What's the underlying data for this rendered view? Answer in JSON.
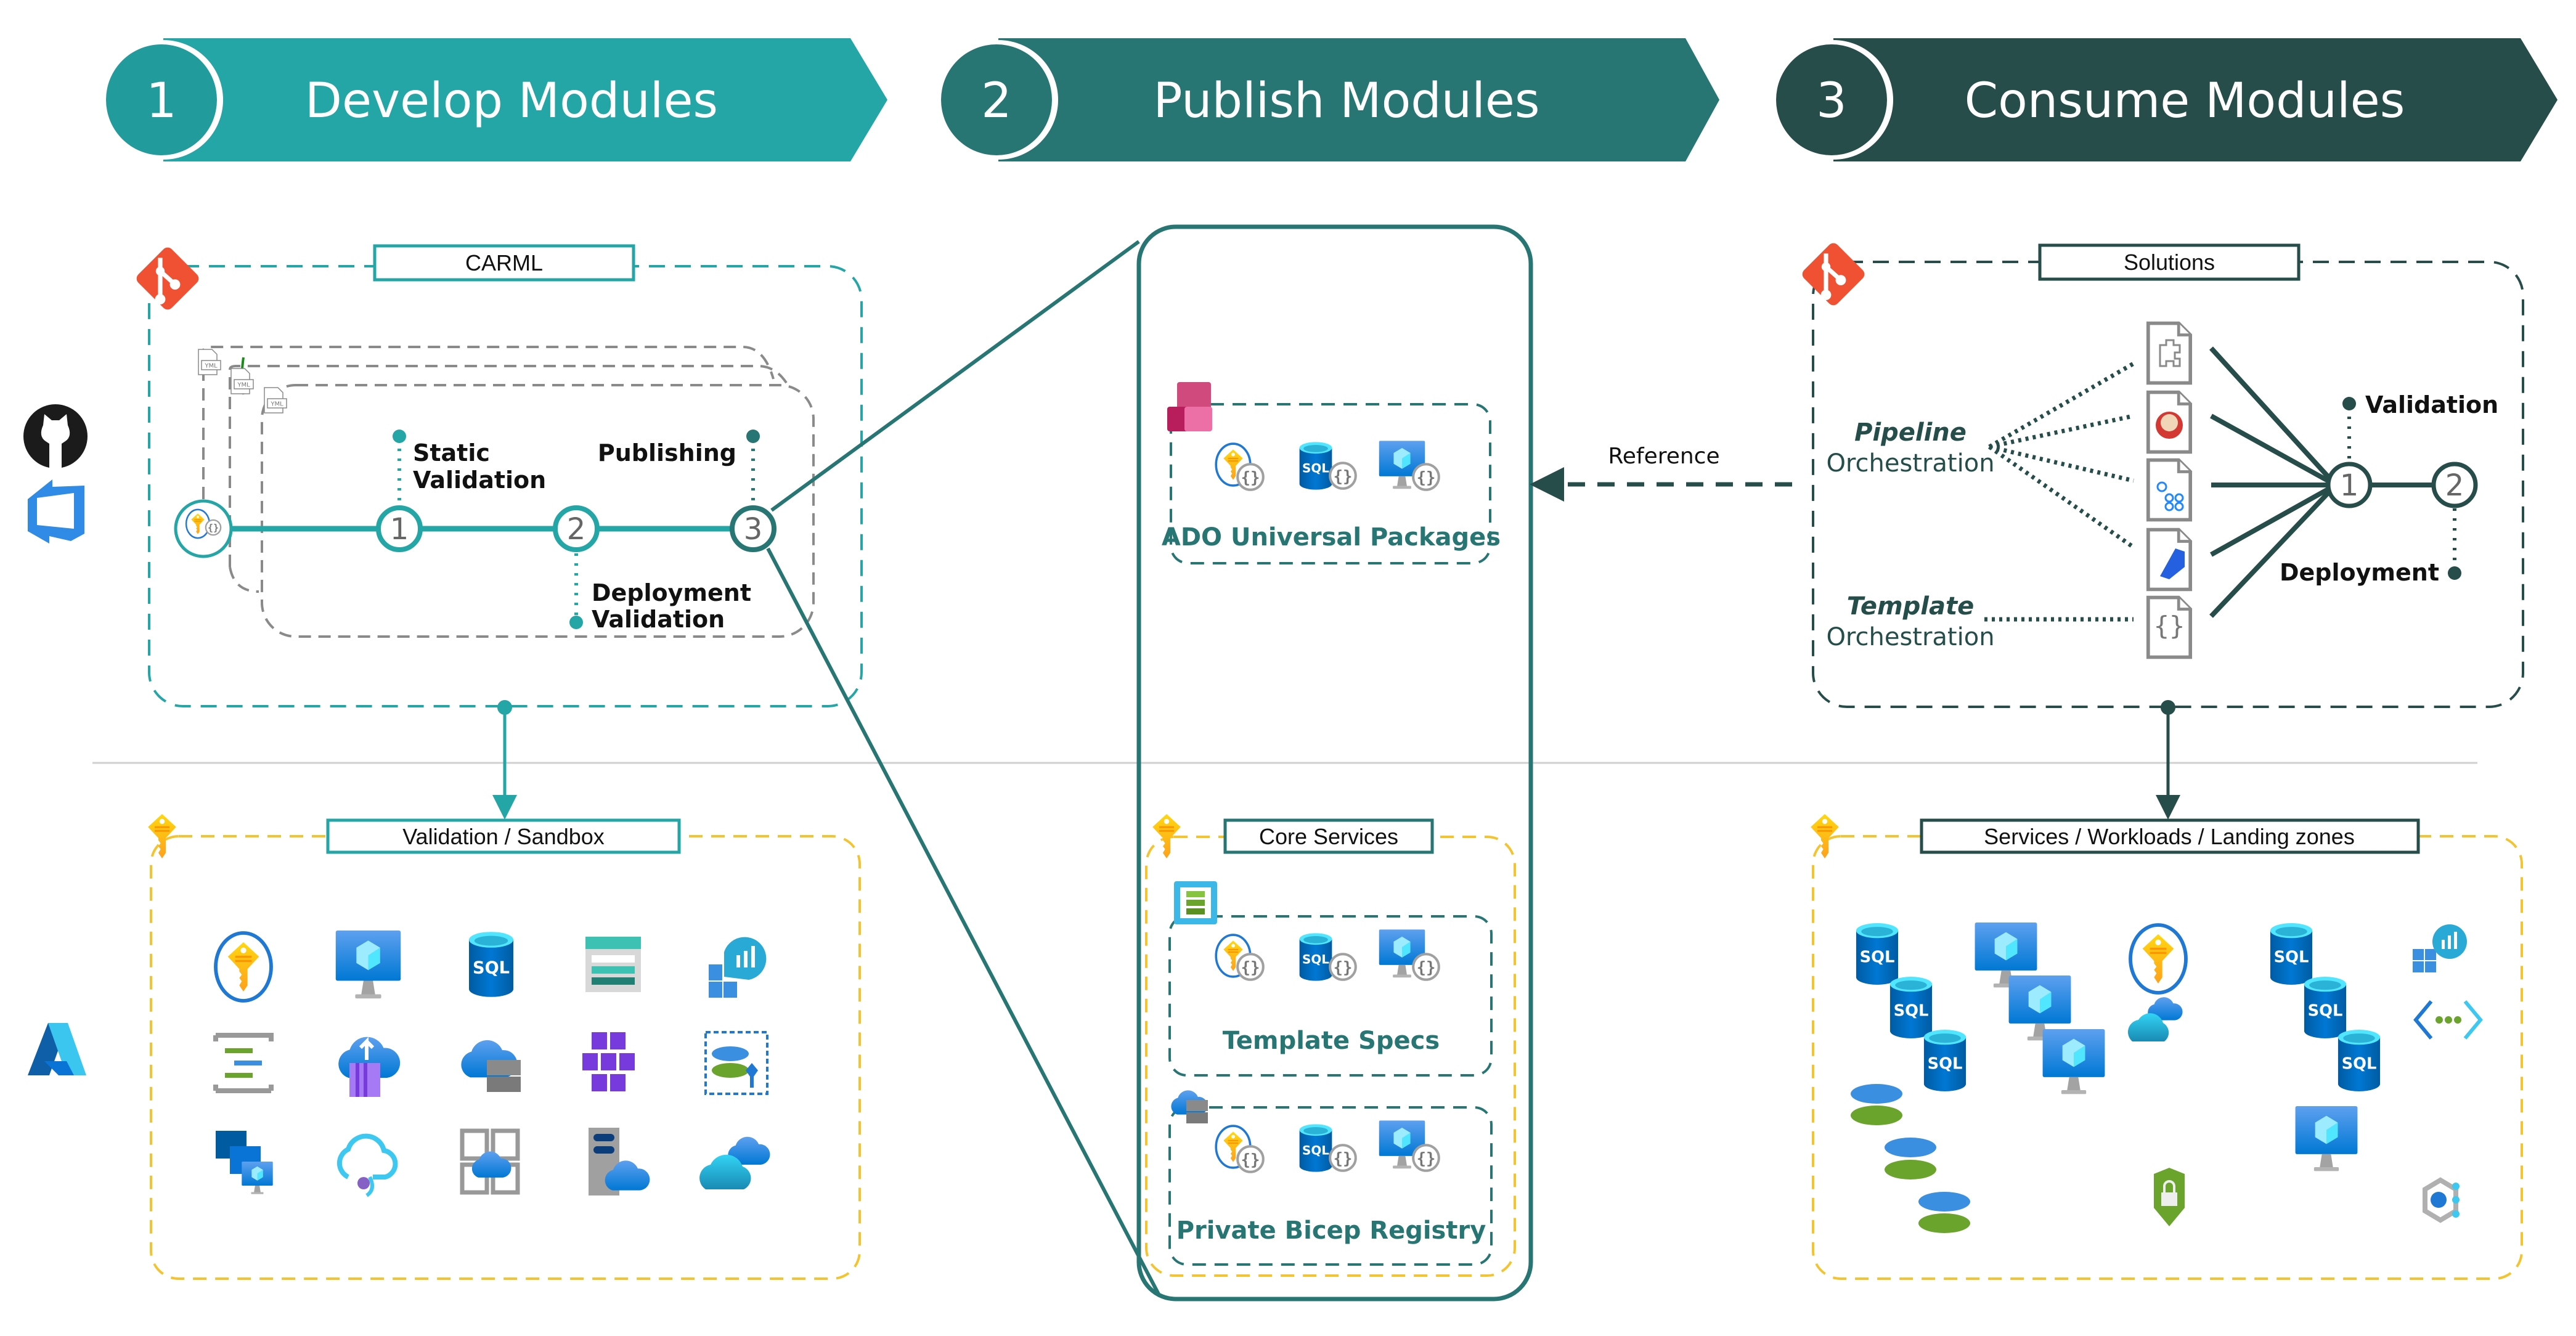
{
  "colors": {
    "step1": "#24a5a6",
    "step2": "#277674",
    "step3": "#264d49",
    "git": "#f05133",
    "key_yellow": "#f5c000",
    "dash_yellow": "#f4c430",
    "azure_blue": "#1e78d4"
  },
  "banners": [
    {
      "number": "1",
      "title": "Develop Modules"
    },
    {
      "number": "2",
      "title": "Publish Modules"
    },
    {
      "number": "3",
      "title": "Consume Modules"
    }
  ],
  "left_logos": [
    "github-icon",
    "azure-devops-icon",
    "azure-icon"
  ],
  "develop": {
    "repo_title": "CARML",
    "yml_label": "YML",
    "pipeline_steps": [
      {
        "number": "1",
        "label_line1": "Static",
        "label_line2": "Validation"
      },
      {
        "number": "2",
        "label_line1": "Deployment",
        "label_line2": "Validation"
      },
      {
        "number": "3",
        "label_line1": "Publishing",
        "label_line2": ""
      }
    ],
    "sandbox_title": "Validation / Sandbox",
    "sandbox_icons": [
      "key-vault-icon",
      "virtual-machine-icon",
      "sql-database-icon",
      "storage-account-icon",
      "log-analytics-icon",
      "event-hub-icon",
      "container-registry-icon",
      "container-instance-icon",
      "kubernetes-icon",
      "disk-encryption-icon",
      "vm-scale-set-icon",
      "api-connection-icon",
      "app-service-plan-icon",
      "hybrid-server-icon",
      "cloud-sync-icon"
    ]
  },
  "publish": {
    "ado_label": "ADO Universal Packages",
    "core_title": "Core Services",
    "template_specs_label": "Template Specs",
    "bicep_registry_label": "Private Bicep Registry",
    "sql_text": "SQL",
    "module_icons": [
      "key-vault-module-icon",
      "sql-module-icon",
      "vm-module-icon"
    ]
  },
  "reference_label": "Reference",
  "consume": {
    "repo_title": "Solutions",
    "pipeline_orch_line1": "Pipeline",
    "pipeline_orch_line2": "Orchestration",
    "template_orch_line1": "Template",
    "template_orch_line2": "Orchestration",
    "file_icons": [
      "puzzle-file-icon",
      "jenkins-file-icon",
      "github-actions-file-icon",
      "azure-pipelines-file-icon",
      "template-file-icon"
    ],
    "steps": [
      {
        "number": "1",
        "label": "Validation"
      },
      {
        "number": "2",
        "label": "Deployment"
      }
    ],
    "workloads_title": "Services / Workloads / Landing zones",
    "sql_text": "SQL"
  }
}
